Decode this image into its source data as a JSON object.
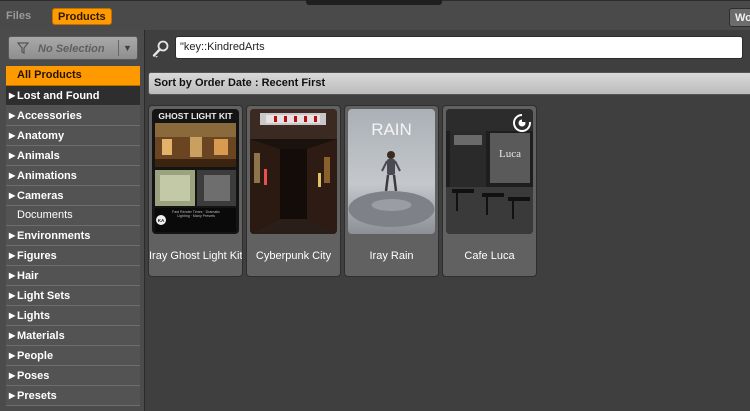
{
  "header": {
    "tab_files": "Files",
    "tab_products": "Products",
    "tab_right": "Wo"
  },
  "filter": {
    "label": "No Selection"
  },
  "categories": [
    {
      "label": "All Products",
      "arrow": false,
      "state": "selected"
    },
    {
      "label": "Lost and Found",
      "arrow": true,
      "state": "dark"
    },
    {
      "label": "Accessories",
      "arrow": true,
      "state": "normal"
    },
    {
      "label": "Anatomy",
      "arrow": true,
      "state": "normal"
    },
    {
      "label": "Animals",
      "arrow": true,
      "state": "normal"
    },
    {
      "label": "Animations",
      "arrow": true,
      "state": "normal"
    },
    {
      "label": "Cameras",
      "arrow": true,
      "state": "normal"
    },
    {
      "label": "Documents",
      "arrow": false,
      "state": "plain"
    },
    {
      "label": "Environments",
      "arrow": true,
      "state": "normal"
    },
    {
      "label": "Figures",
      "arrow": true,
      "state": "normal"
    },
    {
      "label": "Hair",
      "arrow": true,
      "state": "normal"
    },
    {
      "label": "Light Sets",
      "arrow": true,
      "state": "normal"
    },
    {
      "label": "Lights",
      "arrow": true,
      "state": "normal"
    },
    {
      "label": "Materials",
      "arrow": true,
      "state": "normal"
    },
    {
      "label": "People",
      "arrow": true,
      "state": "normal"
    },
    {
      "label": "Poses",
      "arrow": true,
      "state": "normal"
    },
    {
      "label": "Presets",
      "arrow": true,
      "state": "normal"
    }
  ],
  "search": {
    "value": "\"key::KindredArts"
  },
  "sort": {
    "label": "Sort by Order Date : Recent First"
  },
  "products": [
    {
      "name": "Iray Ghost Light Kit",
      "thumb_title": "GHOST LIGHT KIT",
      "thumb_caption": "Fast Render Times · Dramatic Lighting · Many Presets",
      "badge": "KA"
    },
    {
      "name": "Cyberpunk City",
      "thumb_title": "",
      "thumb_caption": "",
      "badge": ""
    },
    {
      "name": "Iray Rain",
      "thumb_title": "RAIN",
      "thumb_caption": "",
      "badge": ""
    },
    {
      "name": "Cafe Luca",
      "thumb_title": "Luca",
      "thumb_caption": "",
      "badge": ""
    }
  ],
  "colors": {
    "accent": "#ff9900",
    "panel": "#4b4b4b",
    "background": "#3f3f3f"
  }
}
